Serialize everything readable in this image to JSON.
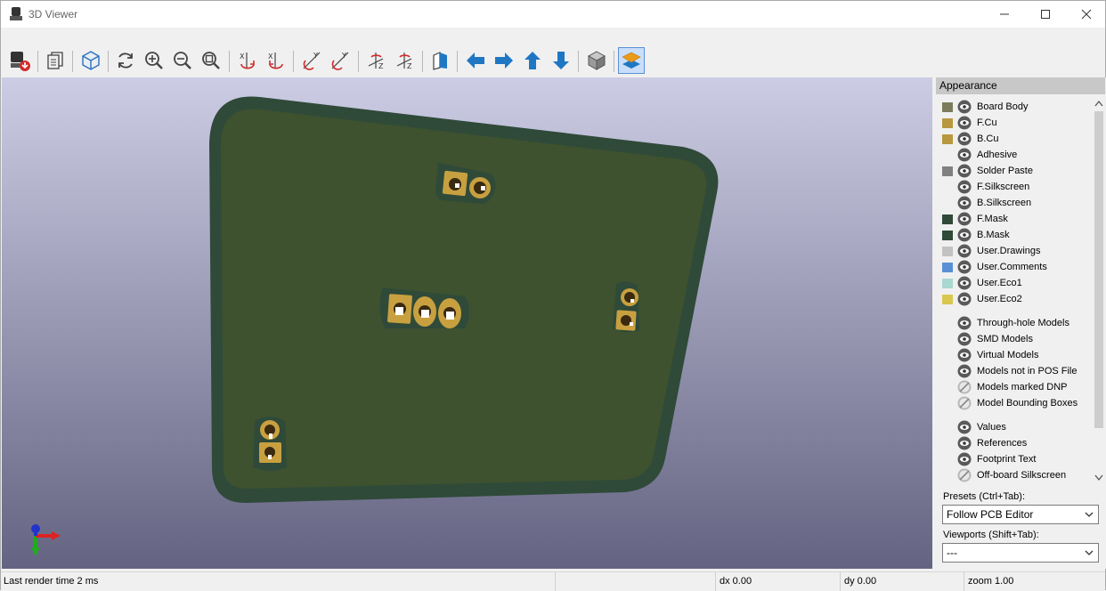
{
  "window": {
    "title": "3D Viewer"
  },
  "toolbar": {
    "buttons": [
      "render-options-button",
      "copy-image-button",
      "raytrace-button",
      "reload-button",
      "zoom-in-button",
      "zoom-out-button",
      "zoom-fit-button",
      "rotate-x-cw-button",
      "rotate-x-ccw-button",
      "rotate-y-cw-button",
      "rotate-y-ccw-button",
      "rotate-z-cw-button",
      "rotate-z-ccw-button",
      "flip-board-button",
      "move-left-button",
      "move-right-button",
      "move-up-button",
      "move-down-button",
      "orthographic-button",
      "toggle-layers-panel-button"
    ]
  },
  "appearance": {
    "header": "Appearance",
    "layers": [
      {
        "label": "Board Body",
        "color": "#7c7c5c",
        "visible": true
      },
      {
        "label": "F.Cu",
        "color": "#b8983f",
        "visible": true
      },
      {
        "label": "B.Cu",
        "color": "#b8983f",
        "visible": true
      },
      {
        "label": "Adhesive",
        "color": "",
        "visible": true
      },
      {
        "label": "Solder Paste",
        "color": "#808080",
        "visible": true
      },
      {
        "label": "F.Silkscreen",
        "color": "",
        "visible": true
      },
      {
        "label": "B.Silkscreen",
        "color": "",
        "visible": true
      },
      {
        "label": "F.Mask",
        "color": "#2f4a38",
        "visible": true
      },
      {
        "label": "B.Mask",
        "color": "#2f4a38",
        "visible": true
      },
      {
        "label": "User.Drawings",
        "color": "#c2c2c2",
        "visible": true
      },
      {
        "label": "User.Comments",
        "color": "#5a8fd6",
        "visible": true
      },
      {
        "label": "User.Eco1",
        "color": "#a8d8d0",
        "visible": true
      },
      {
        "label": "User.Eco2",
        "color": "#d8c850",
        "visible": true
      }
    ],
    "models": [
      {
        "label": "Through-hole Models",
        "visible": true
      },
      {
        "label": "SMD Models",
        "visible": true
      },
      {
        "label": "Virtual Models",
        "visible": true
      },
      {
        "label": "Models not in POS File",
        "visible": true
      },
      {
        "label": "Models marked DNP",
        "visible": false
      },
      {
        "label": "Model Bounding Boxes",
        "visible": false
      }
    ],
    "text": [
      {
        "label": "Values",
        "visible": true
      },
      {
        "label": "References",
        "visible": true
      },
      {
        "label": "Footprint Text",
        "visible": true
      },
      {
        "label": "Off-board Silkscreen",
        "visible": false
      }
    ],
    "presets_label": "Presets (Ctrl+Tab):",
    "presets_value": "Follow PCB Editor",
    "viewports_label": "Viewports (Shift+Tab):",
    "viewports_value": "---"
  },
  "status": {
    "render_time": "Last render time 2 ms",
    "dx": "dx 0.00",
    "dy": "dy 0.00",
    "zoom": "zoom 1.00"
  }
}
